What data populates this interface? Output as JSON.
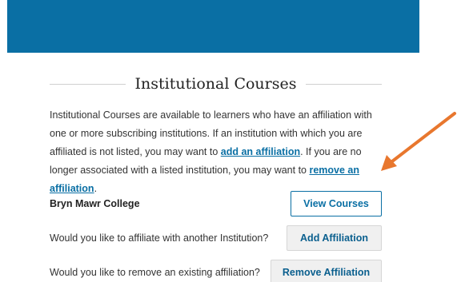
{
  "header": {
    "color": "#0a6fa4"
  },
  "section": {
    "title": "Institutional Courses"
  },
  "intro": {
    "text_1": "Institutional Courses are available to learners who have an affiliation with one or more subscribing institutions. If an institution with which you are affiliated is not listed, you may want to ",
    "add_link": "add an affiliation",
    "text_2": ". If you are no longer associated with a listed institution, you may want to ",
    "remove_link": "remove an affiliation",
    "text_3": "."
  },
  "rows": {
    "institution": {
      "label": "Bryn Mawr College",
      "button": "View Courses"
    },
    "add": {
      "label": "Would you like to affiliate with another Institution?",
      "button": "Add Affiliation"
    },
    "remove": {
      "label": "Would you like to remove an existing affiliation?",
      "button": "Remove Affiliation"
    }
  },
  "annotation": {
    "arrow_color": "#e8772e"
  }
}
